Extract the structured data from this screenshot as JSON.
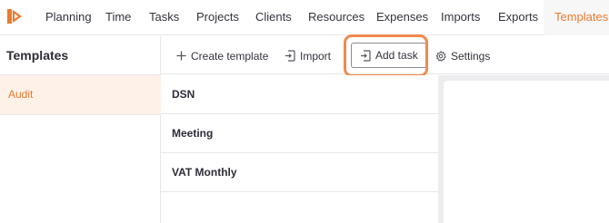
{
  "nav": {
    "items": [
      {
        "label": "Planning"
      },
      {
        "label": "Time"
      },
      {
        "label": "Tasks"
      },
      {
        "label": "Projects"
      },
      {
        "label": "Clients"
      },
      {
        "label": "Resources"
      },
      {
        "label": "Expenses"
      },
      {
        "label": "Imports"
      },
      {
        "label": "Exports"
      },
      {
        "label": "Templates"
      }
    ],
    "active": "Templates",
    "accent_color": "#ec7a2c"
  },
  "sidebar": {
    "title": "Templates",
    "items": [
      {
        "label": "Audit",
        "selected": true
      }
    ]
  },
  "toolbar": {
    "create_label": "Create template",
    "import_label": "Import",
    "add_task_label": "Add task",
    "settings_label": "Settings",
    "icons": {
      "create": "plus-icon",
      "import": "import-icon",
      "add_task": "add-task-icon",
      "settings": "gear-icon"
    }
  },
  "list": {
    "rows": [
      {
        "label": "DSN"
      },
      {
        "label": "Meeting"
      },
      {
        "label": "VAT Monthly"
      }
    ]
  }
}
